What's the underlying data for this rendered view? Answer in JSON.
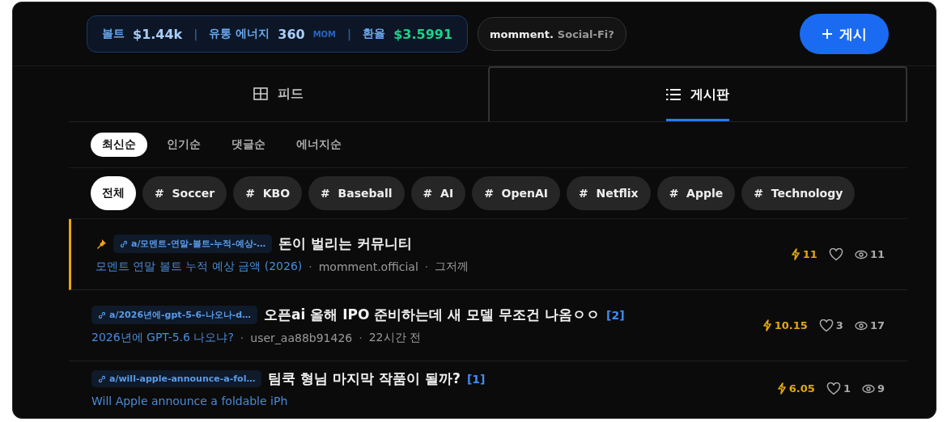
{
  "stats": {
    "volt_label": "볼트",
    "volt_value": "$1.44k",
    "separator_1": "|",
    "energy_label": "유통 에너지",
    "energy_value": "360",
    "energy_unit": "MOM",
    "separator_2": "|",
    "rate_label": "환율",
    "rate_value": "$3.5991"
  },
  "brand": {
    "name": "momment.",
    "tagline": "Social-Fi?"
  },
  "post_button": {
    "label": "게시"
  },
  "view_tabs": [
    {
      "label": "피드",
      "selected": false
    },
    {
      "label": "게시판",
      "selected": true
    }
  ],
  "sort_tabs": [
    {
      "label": "최신순",
      "selected": true
    },
    {
      "label": "인기순",
      "selected": false
    },
    {
      "label": "댓글순",
      "selected": false
    },
    {
      "label": "에너지순",
      "selected": false
    }
  ],
  "tags": [
    {
      "label": "전체",
      "selected": true
    },
    {
      "label": "Soccer",
      "hash": "#",
      "selected": false
    },
    {
      "label": "KBO",
      "hash": "#",
      "selected": false
    },
    {
      "label": "Baseball",
      "hash": "#",
      "selected": false
    },
    {
      "label": "AI",
      "hash": "#",
      "selected": false
    },
    {
      "label": "OpenAI",
      "hash": "#",
      "selected": false
    },
    {
      "label": "Netflix",
      "hash": "#",
      "selected": false
    },
    {
      "label": "Apple",
      "hash": "#",
      "selected": false
    },
    {
      "label": "Technology",
      "hash": "#",
      "selected": false
    }
  ],
  "posts": [
    {
      "pinned": true,
      "community": "a/모멘트-연말-볼트-누적-예상-…",
      "title": "돈이 벌리는 커뮤니티",
      "market": "모멘트 연말 볼트 누적 예상 금액 (2026)",
      "separator_1": "·",
      "author": "momment.official",
      "separator_2": "·",
      "time": "그저께",
      "energy": "11",
      "views": "11"
    },
    {
      "pinned": false,
      "community": "a/2026년에-gpt-5-6-나오나-d…",
      "title": "오픈ai 올해 IPO 준비하는데 새 모델 무조건 나옴ㅇㅇ",
      "comments": "[2]",
      "market": "2026년에 GPT-5.6 나오냐?",
      "separator_1": "·",
      "author": "user_aa88b91426",
      "separator_2": "·",
      "time": "22시간 전",
      "energy": "10.15",
      "likes": "3",
      "views": "17"
    },
    {
      "pinned": false,
      "community": "a/will-apple-announce-a-fol…",
      "title": "팀쿡 형님 마지막 작품이 될까?",
      "comments": "[1]",
      "market": "Will Apple announce a foldable iPh",
      "energy": "6.05",
      "likes": "1",
      "views": "9"
    }
  ]
}
